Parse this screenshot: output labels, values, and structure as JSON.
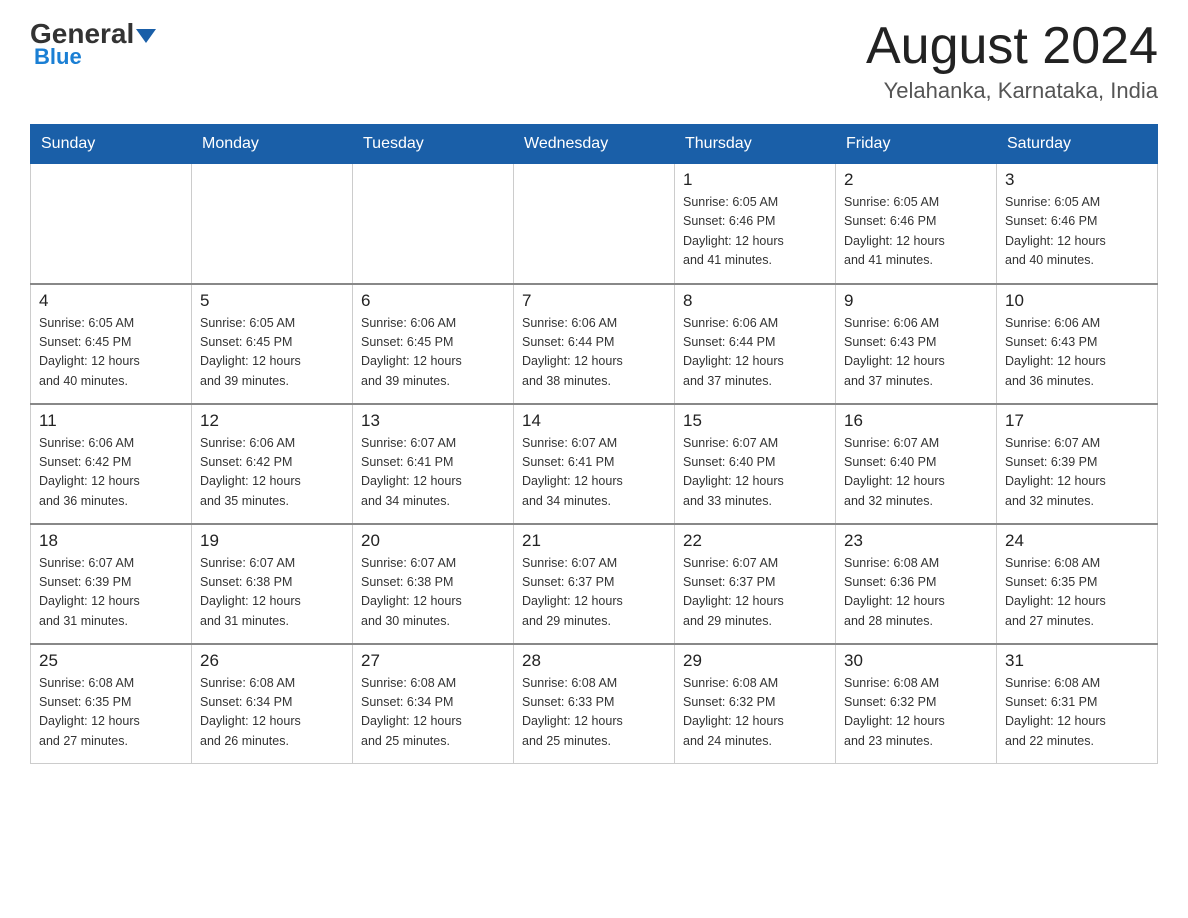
{
  "logo": {
    "general": "General",
    "blue": "Blue"
  },
  "header": {
    "month": "August 2024",
    "location": "Yelahanka, Karnataka, India"
  },
  "days_of_week": [
    "Sunday",
    "Monday",
    "Tuesday",
    "Wednesday",
    "Thursday",
    "Friday",
    "Saturday"
  ],
  "weeks": [
    [
      {
        "day": "",
        "info": ""
      },
      {
        "day": "",
        "info": ""
      },
      {
        "day": "",
        "info": ""
      },
      {
        "day": "",
        "info": ""
      },
      {
        "day": "1",
        "info": "Sunrise: 6:05 AM\nSunset: 6:46 PM\nDaylight: 12 hours\nand 41 minutes."
      },
      {
        "day": "2",
        "info": "Sunrise: 6:05 AM\nSunset: 6:46 PM\nDaylight: 12 hours\nand 41 minutes."
      },
      {
        "day": "3",
        "info": "Sunrise: 6:05 AM\nSunset: 6:46 PM\nDaylight: 12 hours\nand 40 minutes."
      }
    ],
    [
      {
        "day": "4",
        "info": "Sunrise: 6:05 AM\nSunset: 6:45 PM\nDaylight: 12 hours\nand 40 minutes."
      },
      {
        "day": "5",
        "info": "Sunrise: 6:05 AM\nSunset: 6:45 PM\nDaylight: 12 hours\nand 39 minutes."
      },
      {
        "day": "6",
        "info": "Sunrise: 6:06 AM\nSunset: 6:45 PM\nDaylight: 12 hours\nand 39 minutes."
      },
      {
        "day": "7",
        "info": "Sunrise: 6:06 AM\nSunset: 6:44 PM\nDaylight: 12 hours\nand 38 minutes."
      },
      {
        "day": "8",
        "info": "Sunrise: 6:06 AM\nSunset: 6:44 PM\nDaylight: 12 hours\nand 37 minutes."
      },
      {
        "day": "9",
        "info": "Sunrise: 6:06 AM\nSunset: 6:43 PM\nDaylight: 12 hours\nand 37 minutes."
      },
      {
        "day": "10",
        "info": "Sunrise: 6:06 AM\nSunset: 6:43 PM\nDaylight: 12 hours\nand 36 minutes."
      }
    ],
    [
      {
        "day": "11",
        "info": "Sunrise: 6:06 AM\nSunset: 6:42 PM\nDaylight: 12 hours\nand 36 minutes."
      },
      {
        "day": "12",
        "info": "Sunrise: 6:06 AM\nSunset: 6:42 PM\nDaylight: 12 hours\nand 35 minutes."
      },
      {
        "day": "13",
        "info": "Sunrise: 6:07 AM\nSunset: 6:41 PM\nDaylight: 12 hours\nand 34 minutes."
      },
      {
        "day": "14",
        "info": "Sunrise: 6:07 AM\nSunset: 6:41 PM\nDaylight: 12 hours\nand 34 minutes."
      },
      {
        "day": "15",
        "info": "Sunrise: 6:07 AM\nSunset: 6:40 PM\nDaylight: 12 hours\nand 33 minutes."
      },
      {
        "day": "16",
        "info": "Sunrise: 6:07 AM\nSunset: 6:40 PM\nDaylight: 12 hours\nand 32 minutes."
      },
      {
        "day": "17",
        "info": "Sunrise: 6:07 AM\nSunset: 6:39 PM\nDaylight: 12 hours\nand 32 minutes."
      }
    ],
    [
      {
        "day": "18",
        "info": "Sunrise: 6:07 AM\nSunset: 6:39 PM\nDaylight: 12 hours\nand 31 minutes."
      },
      {
        "day": "19",
        "info": "Sunrise: 6:07 AM\nSunset: 6:38 PM\nDaylight: 12 hours\nand 31 minutes."
      },
      {
        "day": "20",
        "info": "Sunrise: 6:07 AM\nSunset: 6:38 PM\nDaylight: 12 hours\nand 30 minutes."
      },
      {
        "day": "21",
        "info": "Sunrise: 6:07 AM\nSunset: 6:37 PM\nDaylight: 12 hours\nand 29 minutes."
      },
      {
        "day": "22",
        "info": "Sunrise: 6:07 AM\nSunset: 6:37 PM\nDaylight: 12 hours\nand 29 minutes."
      },
      {
        "day": "23",
        "info": "Sunrise: 6:08 AM\nSunset: 6:36 PM\nDaylight: 12 hours\nand 28 minutes."
      },
      {
        "day": "24",
        "info": "Sunrise: 6:08 AM\nSunset: 6:35 PM\nDaylight: 12 hours\nand 27 minutes."
      }
    ],
    [
      {
        "day": "25",
        "info": "Sunrise: 6:08 AM\nSunset: 6:35 PM\nDaylight: 12 hours\nand 27 minutes."
      },
      {
        "day": "26",
        "info": "Sunrise: 6:08 AM\nSunset: 6:34 PM\nDaylight: 12 hours\nand 26 minutes."
      },
      {
        "day": "27",
        "info": "Sunrise: 6:08 AM\nSunset: 6:34 PM\nDaylight: 12 hours\nand 25 minutes."
      },
      {
        "day": "28",
        "info": "Sunrise: 6:08 AM\nSunset: 6:33 PM\nDaylight: 12 hours\nand 25 minutes."
      },
      {
        "day": "29",
        "info": "Sunrise: 6:08 AM\nSunset: 6:32 PM\nDaylight: 12 hours\nand 24 minutes."
      },
      {
        "day": "30",
        "info": "Sunrise: 6:08 AM\nSunset: 6:32 PM\nDaylight: 12 hours\nand 23 minutes."
      },
      {
        "day": "31",
        "info": "Sunrise: 6:08 AM\nSunset: 6:31 PM\nDaylight: 12 hours\nand 22 minutes."
      }
    ]
  ]
}
